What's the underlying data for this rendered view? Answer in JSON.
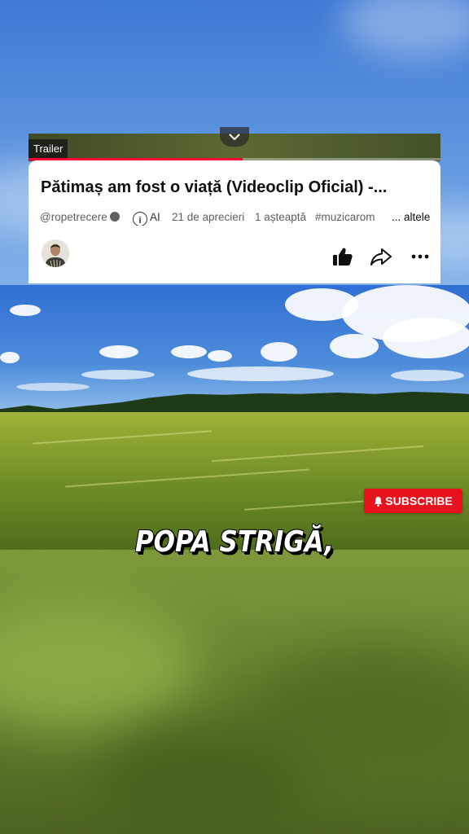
{
  "player": {
    "trailer_label": "Trailer",
    "progress_fraction": 0.52,
    "accent_color": "#ff0033"
  },
  "video": {
    "title": "Pătimaș am fost o viață (Videoclip Oficial) -...",
    "channel_handle": "@ropetrecere",
    "ai_label": "AI",
    "likes_text": "21 de aprecieri",
    "waiting_text": "1 așteaptă",
    "hashtag": "#muzicarom",
    "more_label": "... altele"
  },
  "actions": {
    "like_icon": "thumbs-up-icon",
    "share_icon": "share-icon",
    "more_icon": "more-dots-icon"
  },
  "overlay": {
    "subscribe_label": "SUBSCRIBE",
    "subscribe_color": "#e8111e",
    "caption": "POPA STRIGĂ,"
  }
}
